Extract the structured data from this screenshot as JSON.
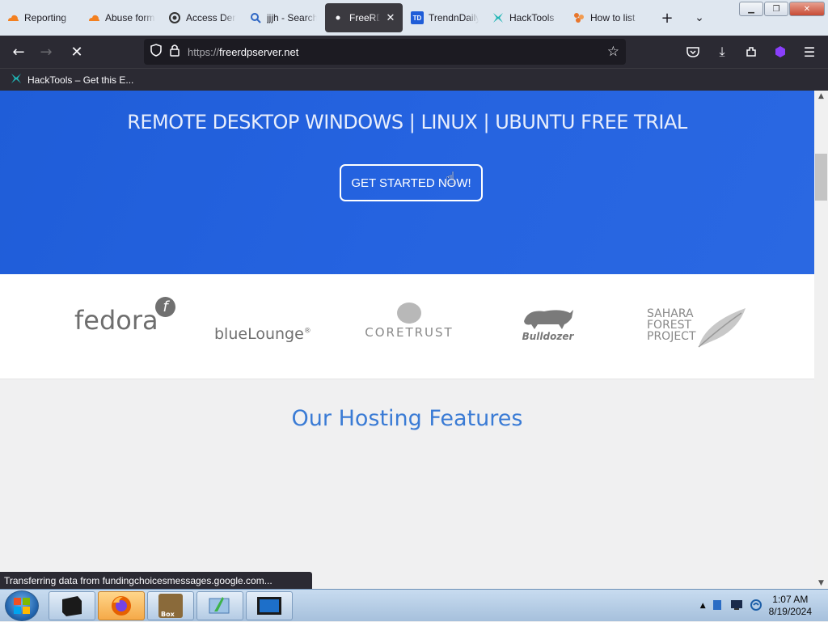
{
  "tabs": [
    {
      "label": "Reporting",
      "icon": "cloudflare-icon",
      "active": false
    },
    {
      "label": "Abuse form",
      "icon": "cloudflare-icon",
      "active": false
    },
    {
      "label": "Access Denied",
      "icon": "access-icon",
      "active": false
    },
    {
      "label": "jjjh - Search",
      "icon": "search-icon",
      "active": false
    },
    {
      "label": "FreeRDP",
      "icon": "dot-icon",
      "active": true
    },
    {
      "label": "TrendnDaily",
      "icon": "td-icon",
      "active": false
    },
    {
      "label": "HackTools",
      "icon": "hacktools-icon",
      "active": false
    },
    {
      "label": "How to list",
      "icon": "puzzle-icon",
      "active": false
    }
  ],
  "tab_td_badge": "TD",
  "url": {
    "protocol": "https://",
    "host": "freerdpserver.net"
  },
  "bookmarks": [
    {
      "label": "HackTools – Get this E..."
    }
  ],
  "hero": {
    "title": "REMOTE DESKTOP WINDOWS | LINUX | UBUNTU FREE TRIAL",
    "cta": "GET STARTED NOW!"
  },
  "logos": {
    "fedora": "fedora",
    "bluelounge": "blueLounge",
    "bluelounge_mark": "®",
    "coretrust": "CORETRUST",
    "bulldozer": "Bulldozer",
    "sahara": [
      "SAHARA",
      "FOREST",
      "PROJECT"
    ]
  },
  "features_heading": "Our Hosting Features",
  "status_message": "Transferring data from fundingchoicesmessages.google.com...",
  "taskbar": {
    "box_label": "Box"
  },
  "clock": {
    "time": "1:07 AM",
    "date": "8/19/2024"
  },
  "colors": {
    "hero": "#2563e0",
    "features": "#3a7bd5",
    "nav": "#2b2a33"
  }
}
